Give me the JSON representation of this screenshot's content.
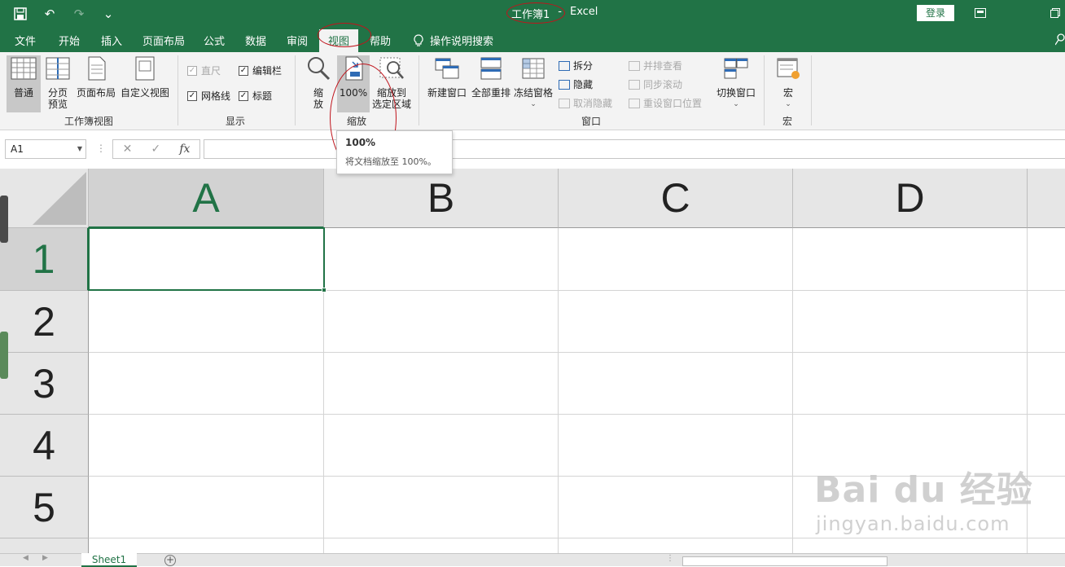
{
  "titlebar": {
    "doc_name": "工作簿1",
    "separator": "-",
    "app_name": "Excel",
    "login_label": "登录"
  },
  "tabs": [
    "文件",
    "开始",
    "插入",
    "页面布局",
    "公式",
    "数据",
    "审阅",
    "视图",
    "帮助"
  ],
  "active_tab": "视图",
  "tell_me": "操作说明搜索",
  "ribbon": {
    "workbook_views": {
      "label": "工作簿视图",
      "normal": "普通",
      "page_break": "分页\n预览",
      "page_layout": "页面布局",
      "custom": "自定义视图"
    },
    "show": {
      "label": "显示",
      "ruler": "直尺",
      "formula_bar": "编辑栏",
      "gridlines": "网格线",
      "headings": "标题"
    },
    "zoom": {
      "label": "缩放",
      "zoom": "缩\n放",
      "zoom_100": "100%",
      "zoom_selection": "缩放到\n选定区域"
    },
    "window": {
      "label": "窗口",
      "new_window": "新建窗口",
      "arrange_all": "全部重排",
      "freeze_panes": "冻结窗格",
      "split": "拆分",
      "hide": "隐藏",
      "unhide": "取消隐藏",
      "side_by_side": "并排查看",
      "sync_scroll": "同步滚动",
      "reset_position": "重设窗口位置",
      "switch_windows": "切换窗口"
    },
    "macros": {
      "label": "宏",
      "macros": "宏"
    }
  },
  "tooltip": {
    "title": "100%",
    "description": "将文档缩放至 100%。"
  },
  "formula_bar": {
    "name_box": "A1",
    "fx": "fx",
    "value": ""
  },
  "grid": {
    "columns": [
      "A",
      "B",
      "C",
      "D"
    ],
    "rows": [
      "1",
      "2",
      "3",
      "4",
      "5"
    ],
    "active_cell": "A1"
  },
  "sheets": [
    "Sheet1"
  ],
  "watermark": {
    "main": "Bai du 经验",
    "sub": "jingyan.baidu.com"
  },
  "colors": {
    "excel_green": "#217346",
    "ribbon_bg": "#f3f3f3",
    "annotation_red": "#c0141c"
  }
}
